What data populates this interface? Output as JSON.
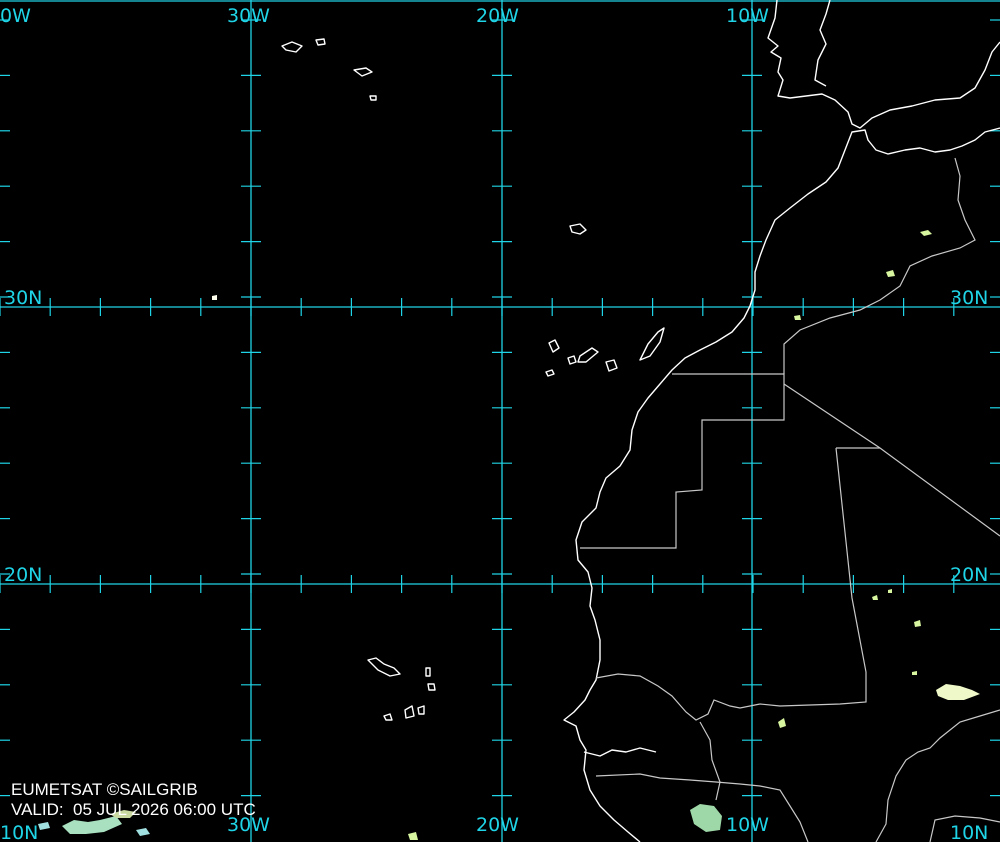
{
  "map": {
    "colors": {
      "grid": "#1fd4e6",
      "coast": "#ffffff",
      "border": "#d0d0d0",
      "cloud": "#d8f5a0"
    },
    "labels": {
      "lon_40w": "0W",
      "lon_30w": "30W",
      "lon_20w": "20W",
      "lon_10w": "10W",
      "lat_30n": "30N",
      "lat_20n": "20N",
      "lat_10n": "10N",
      "lat_10n_right": "10N",
      "lon_30w_bottom": "30W",
      "lon_20w_bottom": "20W",
      "lon_10w_bottom": "10W"
    },
    "credit": "EUMETSAT ©SAILGRIB",
    "valid": "VALID:  05 JUL 2026 06:00 UTC"
  }
}
